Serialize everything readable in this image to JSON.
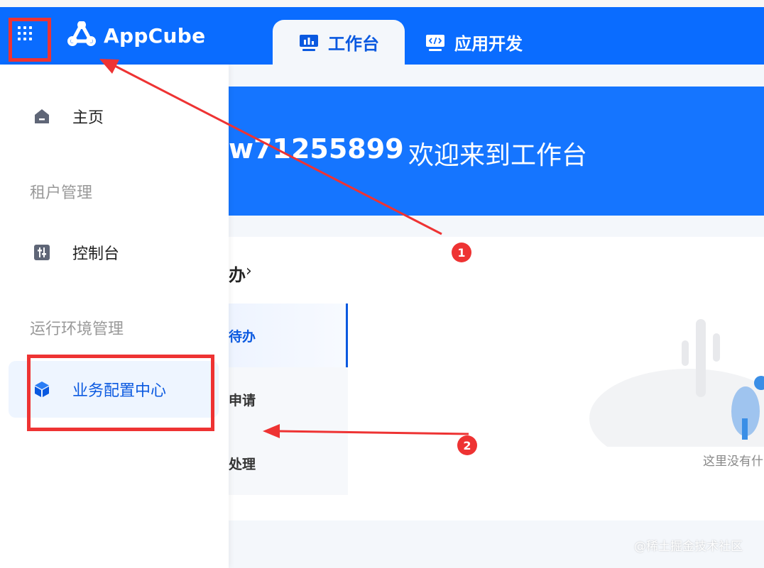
{
  "app": {
    "name": "AppCube"
  },
  "tabs": [
    {
      "label": "工作台",
      "active": true,
      "icon": "dashboard-icon"
    },
    {
      "label": "应用开发",
      "active": false,
      "icon": "code-icon"
    }
  ],
  "banner": {
    "username": "w71255899",
    "welcome": "欢迎来到工作台"
  },
  "tasks": {
    "title": "办",
    "subtabs": [
      {
        "label": "待办",
        "active": true
      },
      {
        "label": "申请",
        "active": false
      },
      {
        "label": "处理",
        "active": false
      }
    ],
    "empty_text": "这里没有什"
  },
  "sidebar": {
    "home": {
      "label": "主页",
      "icon": "home-icon"
    },
    "group_tenant": "租户管理",
    "console": {
      "label": "控制台",
      "icon": "console-icon"
    },
    "group_runtime": "运行环境管理",
    "biz_config": {
      "label": "业务配置中心",
      "icon": "cube-icon",
      "selected": true
    }
  },
  "annotations": {
    "badge1": "1",
    "badge2": "2",
    "color": "#ee3333"
  },
  "watermark": "@稀土掘金技术社区",
  "colors": {
    "primary": "#0a6cff",
    "banner": "#1575ff",
    "active_text": "#0a59e0"
  }
}
